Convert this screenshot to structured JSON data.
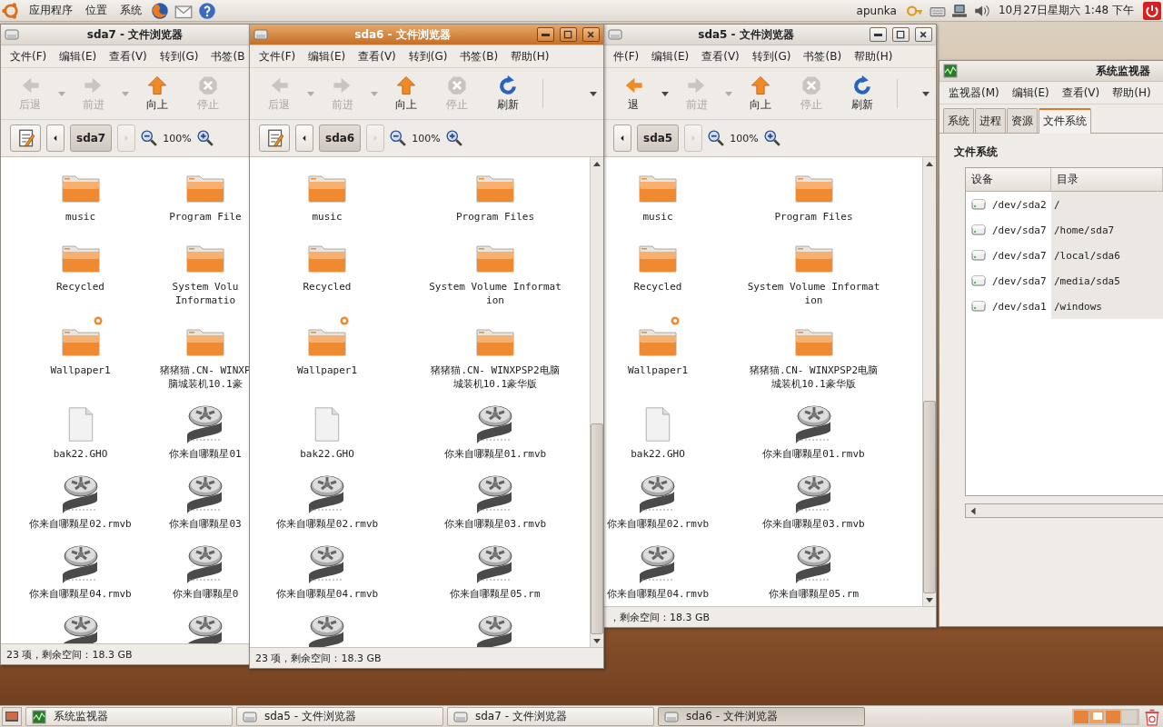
{
  "top_panel": {
    "menus": [
      "应用程序",
      "位置",
      "系统"
    ],
    "user": "apunka",
    "clock": "10月27日星期六 1:48 下午"
  },
  "windows": [
    {
      "kind": "file_browser",
      "title": "sda7 - 文件浏览器",
      "active": false,
      "menus": [
        "文件(F)",
        "编辑(E)",
        "查看(V)",
        "转到(G)",
        "书签(B"
      ],
      "toolbar": [
        {
          "kind": "back",
          "label": "后退",
          "disabled": true
        },
        {
          "kind": "forward",
          "label": "前进",
          "disabled": true
        },
        {
          "kind": "up",
          "label": "向上",
          "disabled": false
        },
        {
          "kind": "stop",
          "label": "停止",
          "disabled": true
        }
      ],
      "location": {
        "edit_toggle": true,
        "path": "sda7",
        "zoom": "100%"
      },
      "items": [
        {
          "kind": "folder",
          "name": "music"
        },
        {
          "kind": "folder",
          "name": "Program File"
        },
        {
          "kind": "folder",
          "name": "Recycled"
        },
        {
          "kind": "folder",
          "name": "System Volu\nInformatio"
        },
        {
          "kind": "folder",
          "name": "Wallpaper1",
          "emblem": true
        },
        {
          "kind": "folder",
          "name": "猪猪猫.CN- WINXP\n脑城装机10.1豪"
        },
        {
          "kind": "file",
          "name": "bak22.GHO"
        },
        {
          "kind": "video",
          "name": "你来自哪颗星01"
        },
        {
          "kind": "video",
          "name": "你来自哪颗星02.rmvb"
        },
        {
          "kind": "video",
          "name": "你来自哪颗星03"
        },
        {
          "kind": "video",
          "name": "你来自哪颗星04.rmvb"
        },
        {
          "kind": "video",
          "name": "你来自哪颗星0"
        },
        {
          "kind": "video"
        },
        {
          "kind": "video"
        }
      ],
      "status": "23 项，剩余空间：18.3 GB"
    },
    {
      "kind": "file_browser",
      "title": "sda6 - 文件浏览器",
      "active": true,
      "menus": [
        "文件(F)",
        "编辑(E)",
        "查看(V)",
        "转到(G)",
        "书签(B)",
        "帮助(H)"
      ],
      "toolbar": [
        {
          "kind": "back",
          "label": "后退",
          "disabled": true
        },
        {
          "kind": "forward",
          "label": "前进",
          "disabled": true
        },
        {
          "kind": "up",
          "label": "向上",
          "disabled": false
        },
        {
          "kind": "stop",
          "label": "停止",
          "disabled": true
        },
        {
          "kind": "refresh",
          "label": "刷新",
          "disabled": false
        }
      ],
      "overflow": true,
      "scrollbar": true,
      "location": {
        "edit_toggle": true,
        "path": "sda6",
        "zoom": "100%"
      },
      "items": [
        {
          "kind": "folder",
          "name": "music"
        },
        {
          "kind": "folder",
          "name": "Program Files"
        },
        {
          "kind": "folder",
          "name": "Recycled"
        },
        {
          "kind": "folder",
          "name": "System Volume Information"
        },
        {
          "kind": "folder",
          "name": "Wallpaper1",
          "emblem": true
        },
        {
          "kind": "folder",
          "name": "猪猪猫.CN- WINXPSP2电脑城装机10.1豪华版"
        },
        {
          "kind": "file",
          "name": "bak22.GHO"
        },
        {
          "kind": "video",
          "name": "你来自哪颗星01.rmvb"
        },
        {
          "kind": "video",
          "name": "你来自哪颗星02.rmvb"
        },
        {
          "kind": "video",
          "name": "你来自哪颗星03.rmvb"
        },
        {
          "kind": "video",
          "name": "你来自哪颗星04.rmvb"
        },
        {
          "kind": "video",
          "name": "你来自哪颗星05.rm"
        },
        {
          "kind": "video"
        },
        {
          "kind": "video"
        }
      ],
      "status": "23 项，剩余空间：18.3 GB"
    },
    {
      "kind": "file_browser",
      "title": "sda5 - 文件浏览器",
      "active": false,
      "menus": [
        "件(F)",
        "编辑(E)",
        "查看(V)",
        "转到(G)",
        "书签(B)",
        "帮助(H)"
      ],
      "toolbar": [
        {
          "kind": "back",
          "label": "退",
          "disabled": false
        },
        {
          "kind": "forward",
          "label": "前进",
          "disabled": true
        },
        {
          "kind": "up",
          "label": "向上",
          "disabled": false
        },
        {
          "kind": "stop",
          "label": "停止",
          "disabled": true
        },
        {
          "kind": "refresh",
          "label": "刷新",
          "disabled": false
        }
      ],
      "overflow": true,
      "scrollbar": true,
      "location": {
        "path": "sda5",
        "zoom": "100%"
      },
      "items": [
        {
          "kind": "folder",
          "name": "music"
        },
        {
          "kind": "folder",
          "name": "Program Files"
        },
        {
          "kind": "folder",
          "name": "Recycled"
        },
        {
          "kind": "folder",
          "name": "System Volume Information"
        },
        {
          "kind": "folder",
          "name": "Wallpaper1",
          "emblem": true
        },
        {
          "kind": "folder",
          "name": "猪猪猫.CN- WINXPSP2电脑城装机10.1豪华版"
        },
        {
          "kind": "file",
          "name": "bak22.GHO"
        },
        {
          "kind": "video",
          "name": "你来自哪颗星01.rmvb"
        },
        {
          "kind": "video",
          "name": "你来自哪颗星02.rmvb"
        },
        {
          "kind": "video",
          "name": "你来自哪颗星03.rmvb"
        },
        {
          "kind": "video",
          "name": "你来自哪颗星04.rmvb"
        },
        {
          "kind": "video",
          "name": "你来自哪颗星05.rm"
        }
      ],
      "status": "，剩余空间：18.3 GB"
    },
    {
      "kind": "system_monitor",
      "title": "系统监视器",
      "active": false,
      "menus": [
        "监视器(M)",
        "编辑(E)",
        "查看(V)",
        "帮助(H)"
      ],
      "tabs": [
        {
          "label": "系统",
          "selected": false
        },
        {
          "label": "进程",
          "selected": false
        },
        {
          "label": "资源",
          "selected": false
        },
        {
          "label": "文件系统",
          "selected": true
        }
      ],
      "heading": "文件系统",
      "columns": [
        "设备",
        "目录"
      ],
      "rows": [
        {
          "device": "/dev/sda2",
          "directory": "/"
        },
        {
          "device": "/dev/sda7",
          "directory": "/home/sda7"
        },
        {
          "device": "/dev/sda7",
          "directory": "/local/sda6"
        },
        {
          "device": "/dev/sda7",
          "directory": "/media/sda5"
        },
        {
          "device": "/dev/sda1",
          "directory": "/windows"
        }
      ]
    }
  ],
  "taskbar": {
    "tasks": [
      {
        "kind": "monitor",
        "label": "系统监视器",
        "selected": false
      },
      {
        "kind": "browser",
        "label": "sda5 - 文件浏览器",
        "selected": false
      },
      {
        "kind": "browser",
        "label": "sda7 - 文件浏览器",
        "selected": false
      },
      {
        "kind": "browser",
        "label": "sda6 - 文件浏览器",
        "selected": true
      }
    ]
  }
}
